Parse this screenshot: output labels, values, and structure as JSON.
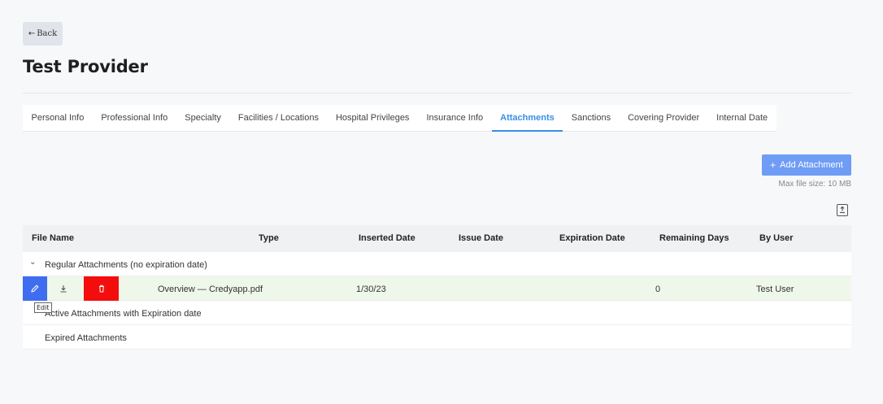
{
  "back_label": "Back",
  "page_title": "Test Provider",
  "tabs": [
    "Personal Info",
    "Professional Info",
    "Specialty",
    "Facilities / Locations",
    "Hospital Privileges",
    "Insurance Info",
    "Attachments",
    "Sanctions",
    "Covering Provider",
    "Internal Date"
  ],
  "active_tab": "Attachments",
  "add_button_label": "Add Attachment",
  "max_file_size": "Max file size: 10 MB",
  "table": {
    "headers": {
      "file_name": "File Name",
      "type": "Type",
      "inserted_date": "Inserted Date",
      "issue_date": "Issue Date",
      "expiration_date": "Expiration Date",
      "remaining_days": "Remaining Days",
      "by_user": "By User"
    },
    "groups": {
      "regular": "Regular Attachments (no expiration date)",
      "active": "Active Attachments with Expiration date",
      "expired": "Expired Attachments"
    },
    "row": {
      "file_name": "Overview — Credyapp.pdf",
      "inserted_date": "1/30/23",
      "issue_date": "",
      "expiration_date": "",
      "remaining_days": "0",
      "by_user": "Test User"
    }
  },
  "tooltip": "Edit",
  "colors": {
    "accent": "#3a8ee6",
    "add_button": "#6f9cf5",
    "edit_button": "#3f6df0",
    "delete_button": "#f40d0d",
    "highlight_row": "#eef7ea"
  },
  "icons": {
    "back": "arrow-left-icon",
    "add": "plus-icon",
    "export": "export-icon",
    "edit": "pencil-icon",
    "download": "download-icon",
    "delete": "trash-icon",
    "expand": "chevron-down-icon"
  }
}
